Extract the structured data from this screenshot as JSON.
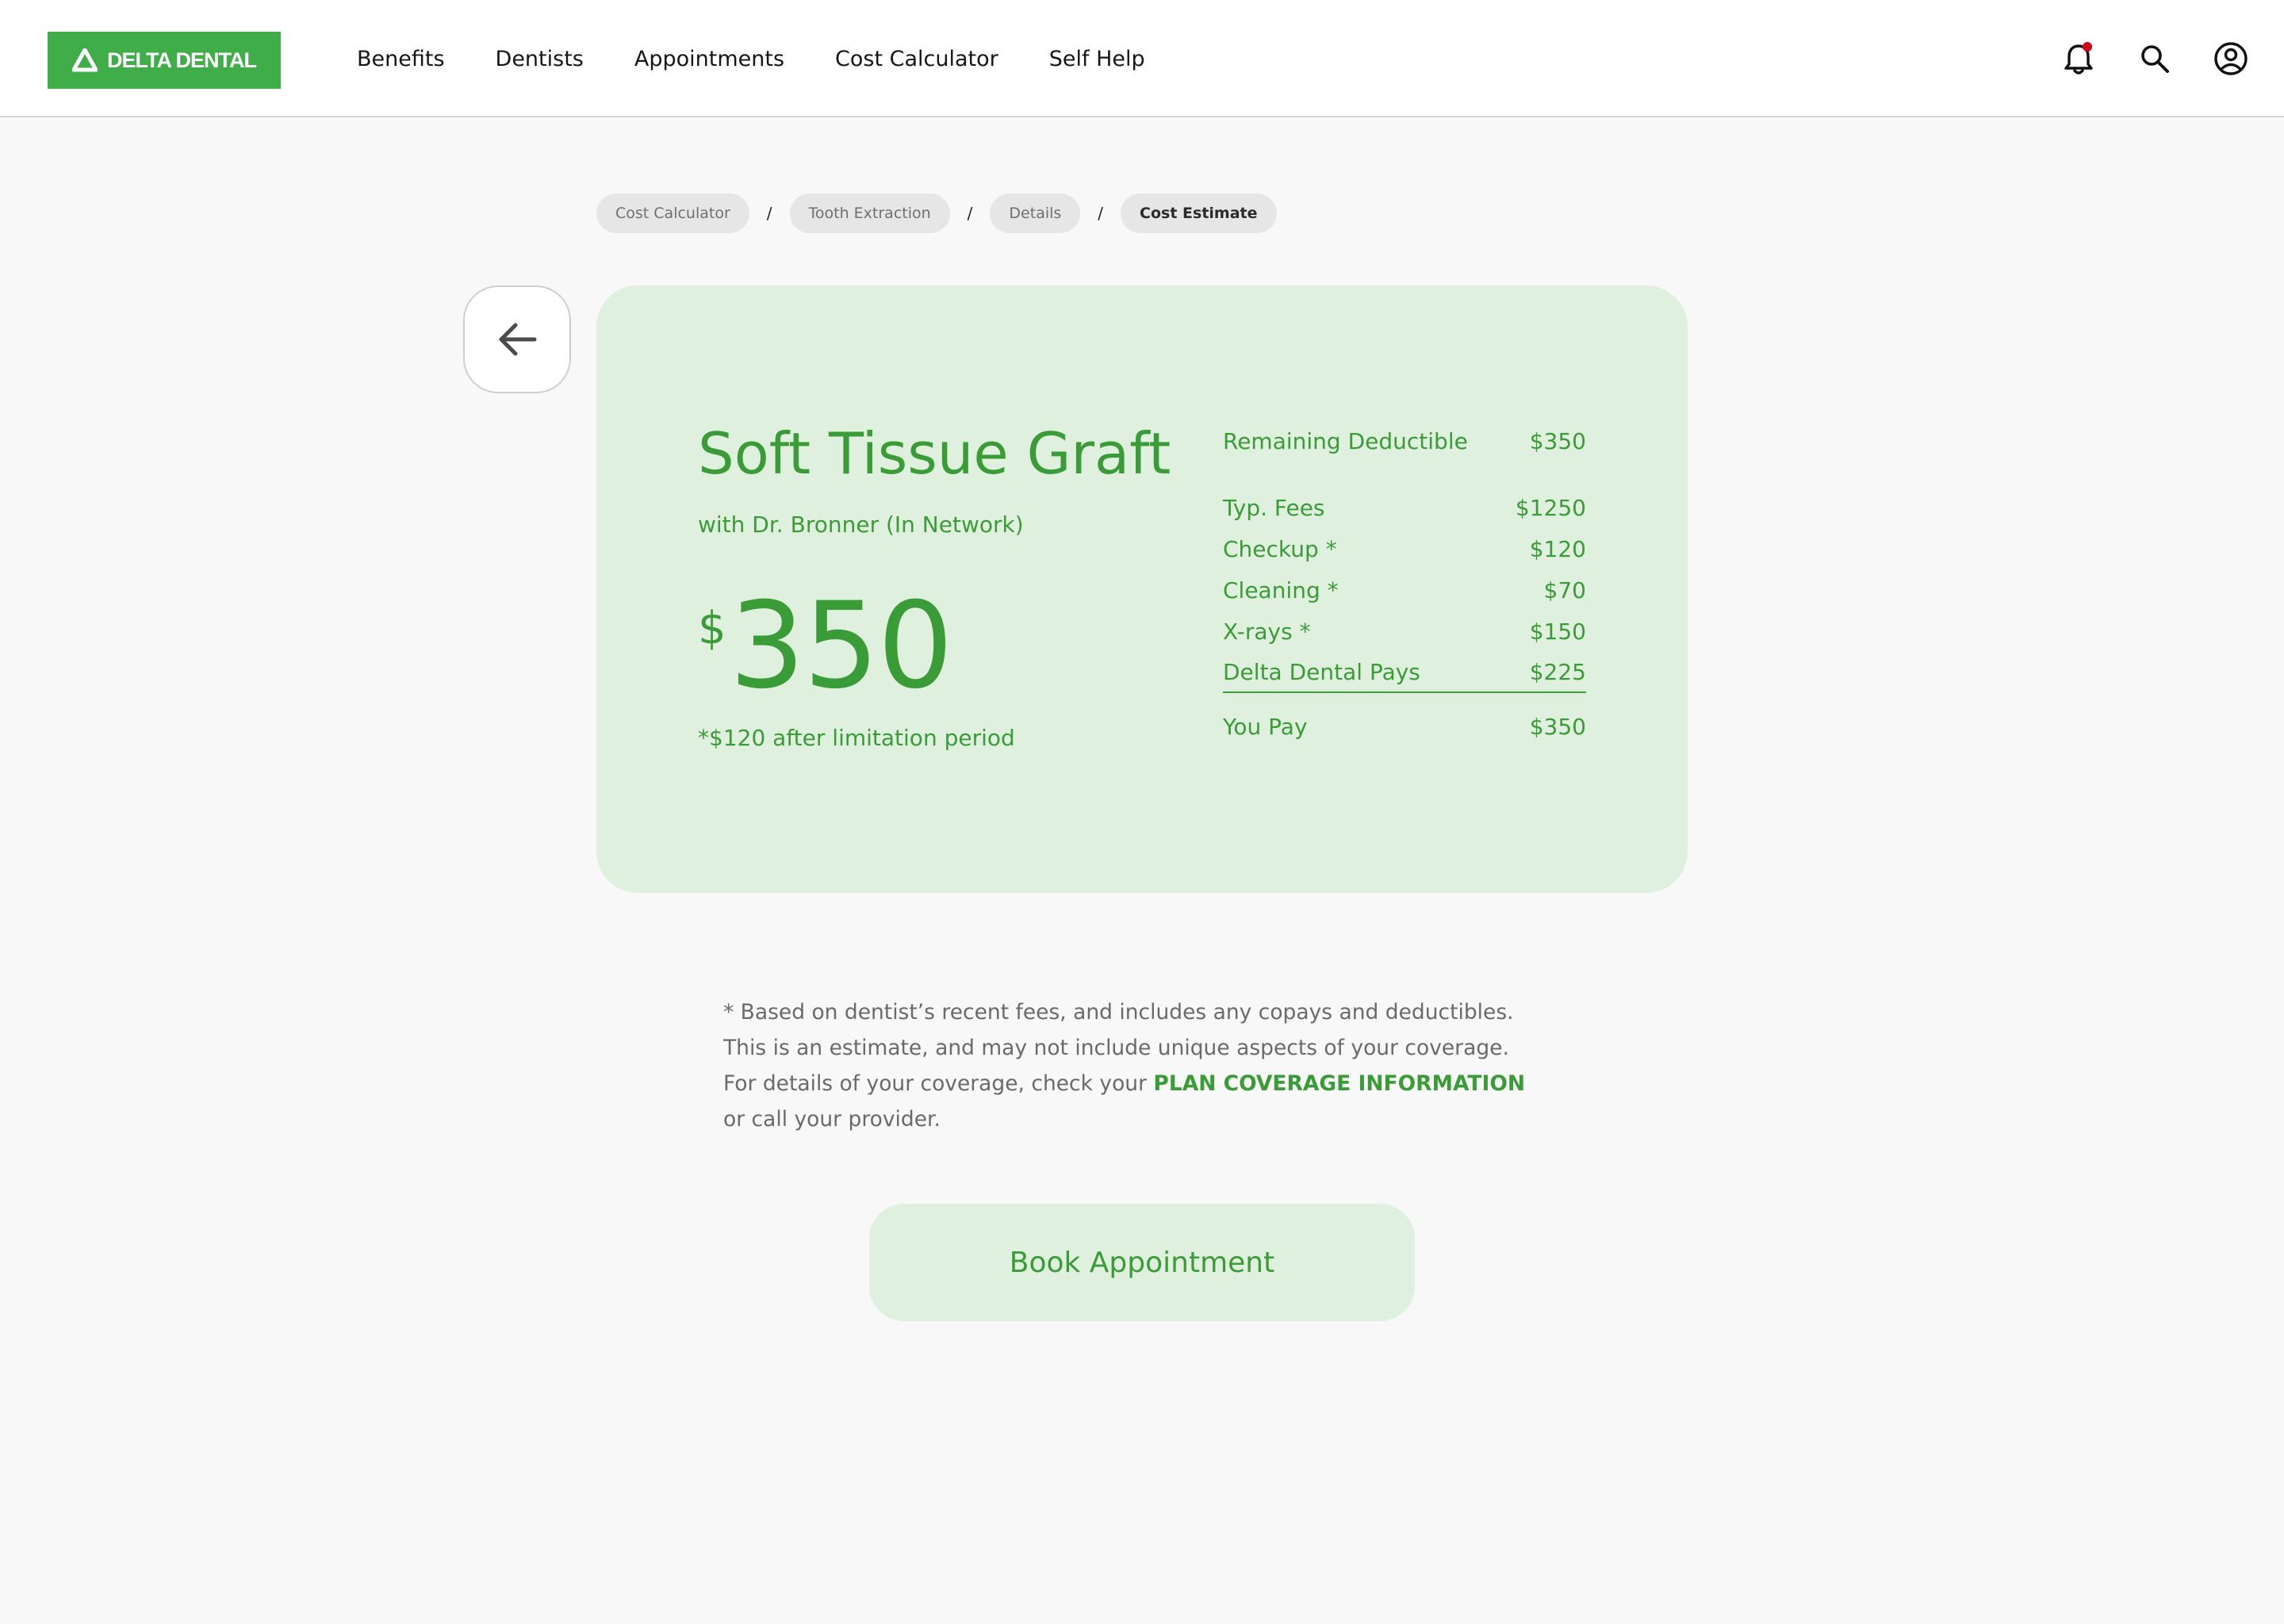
{
  "header": {
    "logo_text": "DELTA DENTAL",
    "nav": [
      "Benefits",
      "Dentists",
      "Appointments",
      "Cost Calculator",
      "Self Help"
    ],
    "icons": [
      "bell-icon",
      "search-icon",
      "account-icon"
    ],
    "notification_dot_color": "#d0021b"
  },
  "breadcrumb": {
    "items": [
      "Cost Calculator",
      "Tooth Extraction",
      "Details",
      "Cost Estimate"
    ],
    "separator": "/"
  },
  "estimate": {
    "title": "Soft Tissue Graft",
    "subtitle": "with Dr. Bronner (In Network)",
    "currency": "$",
    "amount": "350",
    "note": "*$120 after limitation period",
    "deductible": {
      "label": "Remaining Deductible",
      "value": "$350"
    },
    "lines": [
      {
        "label": "Typ. Fees",
        "value": "$1250"
      },
      {
        "label": "Checkup *",
        "value": "$120"
      },
      {
        "label": "Cleaning *",
        "value": "$70"
      },
      {
        "label": "X-rays *",
        "value": "$150"
      },
      {
        "label": "Delta Dental Pays",
        "value": "$225"
      }
    ],
    "total": {
      "label": "You Pay",
      "value": "$350"
    }
  },
  "disclaimer": {
    "before": "* Based on dentist’s recent fees, and includes any copays and deductibles. This is an estimate, and may not include unique aspects of your coverage. For details of your coverage, check your ",
    "link": "PLAN COVERAGE INFORMATION",
    "after": " or call your provider."
  },
  "actions": {
    "book_label": "Book Appointment"
  },
  "colors": {
    "brand_green": "#3fae49",
    "text_green": "#3a9c36",
    "card_bg": "#e0f0df",
    "page_bg": "#f8f8f8"
  }
}
